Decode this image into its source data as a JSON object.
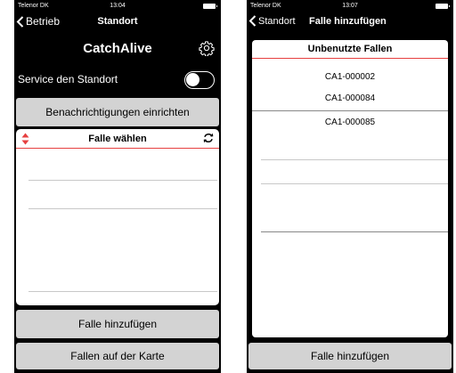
{
  "left_screen": {
    "status_bar": {
      "carrier": "Telenor DK",
      "time": "13:04"
    },
    "nav": {
      "back_label": "Betrieb",
      "title": "Standort"
    },
    "app_title": "CatchAlive",
    "service": {
      "label": "Service den Standort",
      "enabled": false
    },
    "notify_button": "Benachrichtigungen einrichten",
    "trap_picker": {
      "title": "Falle wählen",
      "items": []
    },
    "add_trap_button": "Falle hinzufügen",
    "map_button": "Fallen auf der Karte"
  },
  "right_screen": {
    "status_bar": {
      "carrier": "Telenor DK",
      "time": "13:07"
    },
    "nav": {
      "back_label": "Standort",
      "title": "Falle hinzufügen"
    },
    "unused_traps": {
      "title": "Unbenutzte Fallen",
      "items": [
        "CA1-000002",
        "CA1-000084",
        "CA1-000085"
      ]
    },
    "add_trap_button": "Falle hinzufügen"
  },
  "colors": {
    "accent_line": "#e64040",
    "button_gray": "#d3d3d3",
    "background": "#000000"
  }
}
